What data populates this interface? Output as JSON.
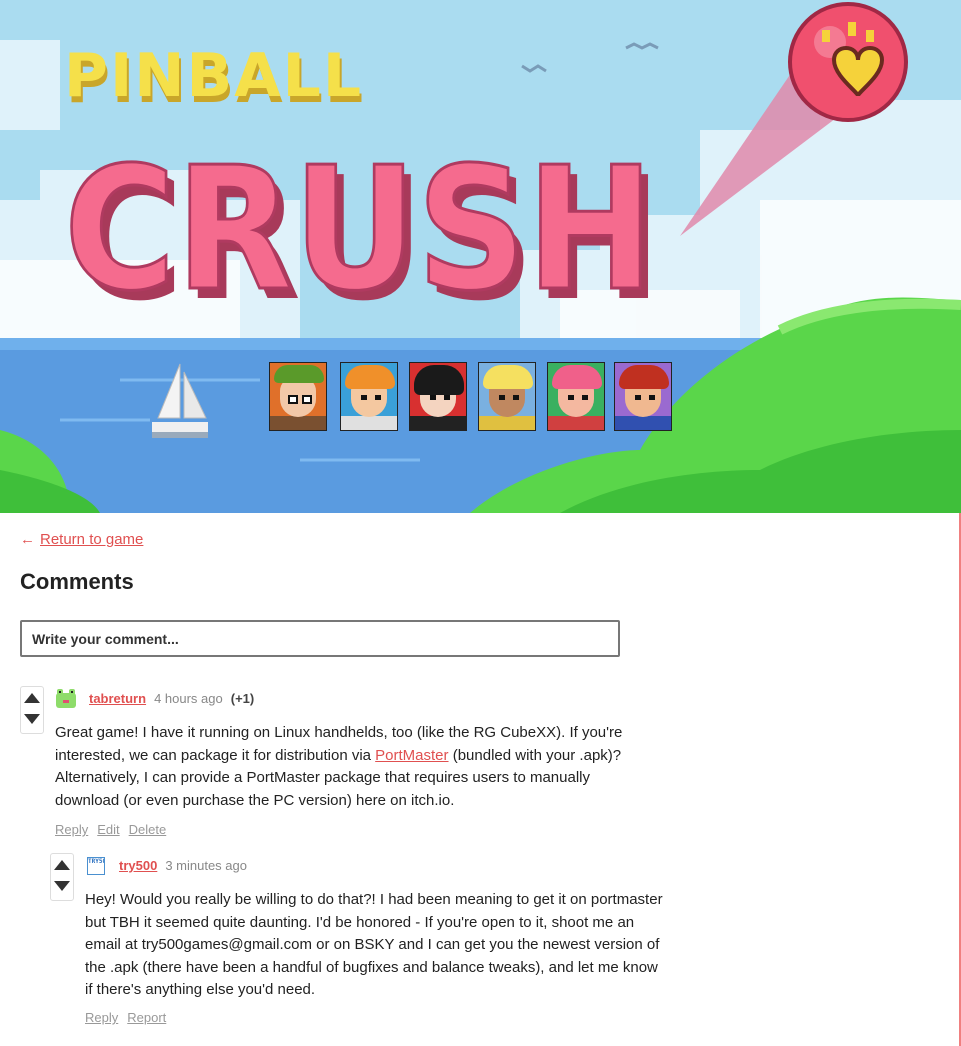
{
  "banner": {
    "logo_line1": "PINBALL",
    "logo_line2": "CRUSH",
    "colors": {
      "sky": "#a9dcf0",
      "sea": "#5a9be0",
      "grass": "#5ad64a",
      "logo_yellow": "#f5e04a",
      "logo_pink": "#f56b8e"
    }
  },
  "nav": {
    "return_arrow": "←",
    "return_label": "Return to game"
  },
  "comments": {
    "title": "Comments",
    "input_placeholder": "Write your comment...",
    "items": [
      {
        "avatar_icon": "frog-avatar-icon",
        "username": "tabreturn",
        "time": "4 hours ago",
        "score": "(+1)",
        "text_before_link": "Great game! I have it running on Linux handhelds, too (like the RG CubeXX). If you're interested, we can package it for distribution via ",
        "link_text": "PortMaster",
        "text_after_link": " (bundled with your .apk)?  Alternatively, I can provide a PortMaster package that requires users to manually download (or even purchase the PC version) here on itch.io.",
        "actions": [
          "Reply",
          "Edit",
          "Delete"
        ]
      },
      {
        "avatar_icon": "try500-logo-avatar-icon",
        "avatar_text": "TRY500",
        "username": "try500",
        "time": "3 minutes ago",
        "text": "Hey! Would you really be willing to do that?! I had been meaning to get it on portmaster but TBH it seemed quite daunting. I'd be honored - If you're open to it, shoot me an email at try500games@gmail.com or on BSKY and I can get you the newest version of the .apk (there have been a handful of bugfixes and balance tweaks), and let me know if there's anything else you'd need.",
        "actions": [
          "Reply",
          "Report"
        ]
      }
    ]
  },
  "accent_color": "#e05050"
}
